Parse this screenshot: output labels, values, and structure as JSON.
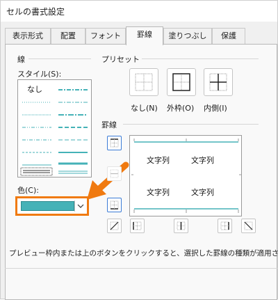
{
  "window": {
    "title": "セルの書式設定"
  },
  "tabs": [
    {
      "label": "表示形式"
    },
    {
      "label": "配置"
    },
    {
      "label": "フォント"
    },
    {
      "label": "罫線",
      "active": true
    },
    {
      "label": "塗りつぶし"
    },
    {
      "label": "保護"
    }
  ],
  "line": {
    "group_label": "線",
    "style_label": "スタイル(S):",
    "none_label": "なし",
    "color_label": "色(C):",
    "color_value": "#45b2b7"
  },
  "presets": {
    "group_label": "プリセット",
    "items": [
      {
        "label": "なし(N)",
        "icon": "border-none-icon"
      },
      {
        "label": "外枠(O)",
        "icon": "border-outline-icon"
      },
      {
        "label": "内側(I)",
        "icon": "border-inside-icon"
      }
    ]
  },
  "border": {
    "group_label": "罫線",
    "preview_text": [
      "文字列",
      "文字列",
      "文字列",
      "文字列"
    ]
  },
  "footer": {
    "hint": "プレビュー枠内または上のボタンをクリックすると、選択した罫線の種類が適用されます"
  },
  "colors": {
    "accent": "#f07a10",
    "line_color": "#45b2b7",
    "selected": "#3b7bd6"
  }
}
